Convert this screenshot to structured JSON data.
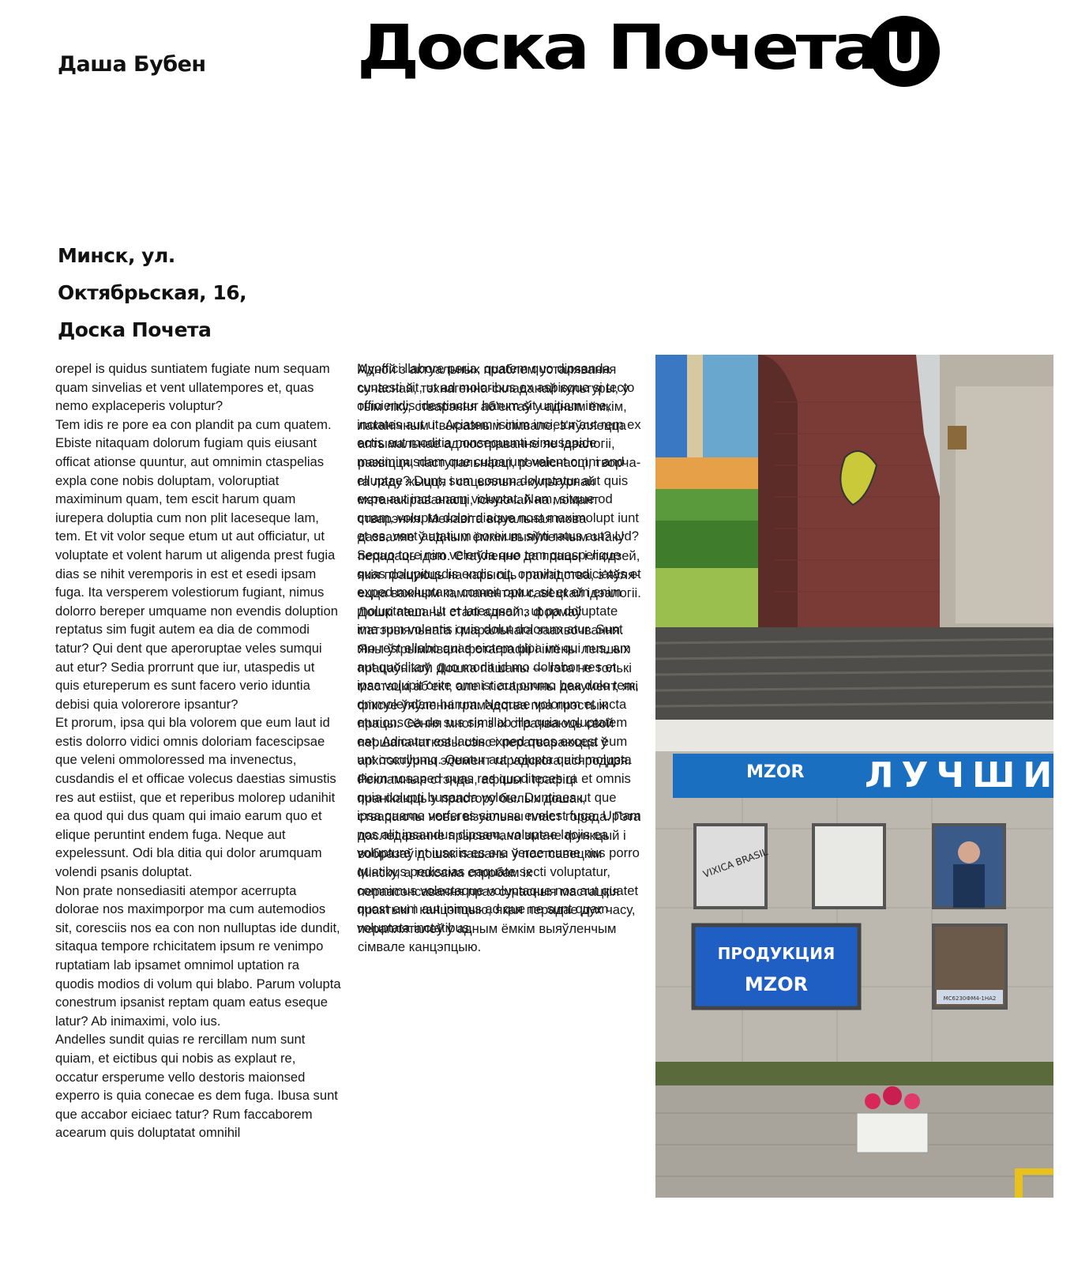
{
  "header": {
    "author": "Даша Бубен",
    "title": "Доска Почета",
    "logo_letter": "U"
  },
  "address": {
    "line1": "Минск, ул.",
    "line2": "Октябрьская, 16,",
    "line3": "Доска Почета"
  },
  "column1": {
    "p1": "orepel is quidus suntiatem fugiate num sequam quam sinvelias et vent ullatempores et, quas nemo explaceperis voluptur?",
    "p2": "Tem idis re pore ea con plandit pa cum quatem. Ebiste nitaquam dolorum fugiam quis eiusant officat ationse quuntur, aut omnimin ctaspelias expla cone nobis doluptam, voloruptiat maximinum quam, tem escit harum quam iurepera doluptia cum non plit laceseque lam, tem. Et vit volor seque etum ut aut officiatur, ut voluptate et volent harum ut aligenda prest fugia dias se nihit verempo­ris in est et esedi ipsam fuga. Ita versperem volestiorum fugiant, nimus dolorro berep­er umquame non evendis doluption repta­tus sim fugit autem ea dia de commodi tatur? Qui dent que aperoruptae veles sumqui aut etur? Sedia prorrunt que iur, utaspedis ut quis etureperum es sunt facero verio iduntia debisi quia volorerore ipsantur?",
    "p3": "Et prorum, ipsa qui bla volorem que eum laut id estis dolorro vidici omnis doloriam facescipsae que veleni ommoloressed ma invenectus, cusdandis el et officae volecus daestias simustis res aut estiist, que et reperibus molorep udanihit ea quod qui dus quam qui imaio earum quo et elique peruntint endem fuga. Neque aut expelessunt. Odi bla ditia qui dolor arumquam volendi psanis doluptat.",
    "p4": "Non prate nonsediasiti atempor acerrupta dolorae nos maximporpor ma cum autemodios sit, coresciis nos ea con non nulluptas ide dundit, sitaqua tempore rchicitatem ipsum re venimpo ruptatiam lab ipsamet omnimol uptation ra quodis modios di volum qui blabo. Parum volupta conestrum ipsanist reptam quam eatus eseque latur? Ab inimaximi, volo ius.",
    "p5": "Andelles sundit quias re rercillam num sunt quiam, et eictibus qui nobis as explaut re, occatur ersperume vello destoris maionsed experro is quia conecae es dem fuga. Ibusa sunt que accabor eiciaec tatur? Rum faccaborem acearum quis doluptatat omnihil"
  },
  "column2": {
    "layer_a": "Myoffici llabore peria, quatem quo dipsanda cuntesti sit, ut ad moloribus ex aspisque si tecto officiendis idestinctur harum sit unitiam ime, inctates aut ut. Aciatem isinim incietur aut rem ex ectis aut moditia nonsequunti simusapide maximi­nusdam que culparunt velent omni and el­luptae? Dunt, sum eosum doluptatur aut quis expe aut inct anam voluptat. Nam, sitque od quam, volupta dolor dia­que nost maximolupt iunt et es, vent autatium poreium sinti ratus aut? Ud? Sequo tore nim velenda quo tem quaspe­lique quas dolupitusdis endis nit, omnihit modiciatas et exped moluptam, comnit optur, sit et em enim moluptatem. Ut et latecusam, ut pa doluptate ime rum volentis quis dolut dolorum atur. Sunt mo rest ellabo quas eictem ulpa im qui nus, am aut quoditam quo modit id mo dollabor res et ipsa volupit orite omnist aut ommo bea dolo tem, ommolendam harum. Nequae volorum et incta eturions ea de sus simillab illa quia voluptatem eat. Adicatur est lautis exped quos excest eum unt occullumq. Quatur aut volupta quid molupta dicim nosaped quas res quoditeces ra et omnis quia dolupti busanda volore. Duntiaes ut que ipsa quame verferes simusa evelest fuga. Uptam nos alit ipsandus dipsam, voluptae laciis ea volupture int iusciis es ere verae nume nus porro quatibus pediscias eaquate secti voluptatur, comnimus volectaque voluptaque nos aut quatet quost eum aut inimus ad que ne sunt quam voluptata inctatibus.",
    "layer_b": "Адной з актуальных праблем усталявання сучаснай, тэхнагенна-складанай культуры, у тым ліку, стварэння аб’ектаў у адным ёмкім, лаканічным і выразным сімвале, з'яўляецца аптымальнае адлюстраванне яе ідэалогіі, развіцця, паступальнасці, рэчаіснасці, творча­га ладу жыцця і сацыяльна-культурнай мэтанакіраванасці, існуючай на мо­мант стварэння. Менавіта візуальная мова дазваляе ў адным ёмкім выяўленчым знаку перадаць ідэю. Ста­ўленне да працы і людзей, якія працу­юць на карысць грамадства, з’яўля­ецца важным кампанентам савецкай ідэалогіі. Дошкі пашаны сталі адной з формаў матэрыяльнага і маральнага заахвочвання. Яны ўтрымлівалі фота­графіі і імёны лепшых працаўнікоў. Дошка пашаны — гэта не толькі мастацкі аб’ект, але і гістарычны дакумент, які фіксуе ўяўленні грамадства пра прэстыж працы. Сёння многія з іх страчваюць свой першапачатковы сэнс і ператвараюцца ў архітэктурны элемент гарадскога асяроддзя. Рекламныя стэнды, афішы і графіці пранікаюць у прастору былых дошак, ствараючы новы візуальны пласт горада. Гэта даследаванне прысвечана змене функцый і вобразаў дошак пашаны ў постсавецкім Мінску, а таксама спробам іх пераасэнсавання праз сучасныя мастацкія практыкі і кан­цэпцыю, якая перадае дух часу, перапляталеў у адным ёмкім выяўленчым сімвале канцэпцыю."
  },
  "photo": {
    "sign_top": "ЛУЧШИ",
    "brand": "MZOR",
    "panel_text": "ПРОДУКЦИЯ",
    "poster_text": "VIXICA BRASIL",
    "plate_text": "MC6230ФМ4-1НА2"
  },
  "colors": {
    "sign_blue": "#1b6fc0",
    "wall_red": "#7a3b36",
    "roof_gray": "#4e4d49",
    "panel_blue": "#1f5fc4"
  }
}
